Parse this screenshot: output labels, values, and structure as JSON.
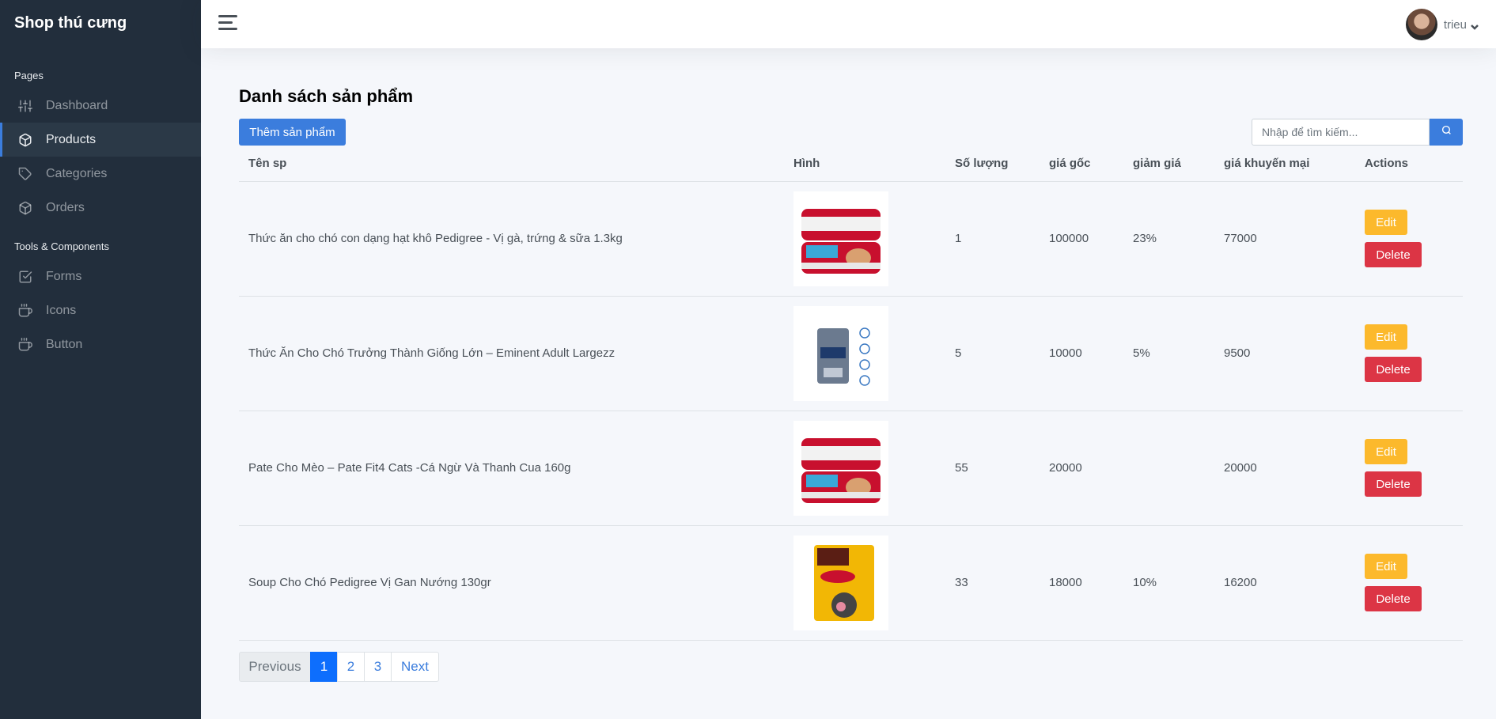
{
  "sidebar": {
    "brand": "Shop thú cưng",
    "section_pages": "Pages",
    "section_tools": "Tools & Components",
    "items": [
      {
        "label": "Dashboard",
        "icon": "sliders-icon"
      },
      {
        "label": "Products",
        "icon": "box-icon",
        "active": true
      },
      {
        "label": "Categories",
        "icon": "tag-icon"
      },
      {
        "label": "Orders",
        "icon": "package-icon"
      },
      {
        "label": "Forms",
        "icon": "check-square-icon"
      },
      {
        "label": "Icons",
        "icon": "coffee-icon"
      },
      {
        "label": "Button",
        "icon": "coffee-icon"
      }
    ]
  },
  "topbar": {
    "username": "trieu"
  },
  "main": {
    "title": "Danh sách sản phẩm",
    "add_button": "Thêm sản phẩm",
    "search_placeholder": "Nhập để tìm kiếm...",
    "columns": [
      "Tên sp",
      "Hình",
      "Số lượng",
      "giá gốc",
      "giảm giá",
      "giá khuyến mại",
      "Actions"
    ],
    "rows": [
      {
        "name": "Thức ăn cho chó con dạng hạt khô Pedigree - Vị gà, trứng & sữa 1.3kg",
        "image": "cat-food-cans",
        "qty": "1",
        "price": "100000",
        "discount": "23%",
        "sale": "77000"
      },
      {
        "name": "Thức Ăn Cho Chó Trưởng Thành Giống Lớn – Eminent Adult Largezz",
        "image": "dog-food-bag",
        "qty": "5",
        "price": "10000",
        "discount": "5%",
        "sale": "9500"
      },
      {
        "name": "Pate Cho Mèo – Pate Fit4 Cats -Cá Ngừ Và Thanh Cua 160g",
        "image": "cat-food-cans",
        "qty": "55",
        "price": "20000",
        "discount": "",
        "sale": "20000"
      },
      {
        "name": "Soup Cho Chó Pedigree Vị Gan Nướng 130gr",
        "image": "pedigree-pouch",
        "qty": "33",
        "price": "18000",
        "discount": "10%",
        "sale": "16200"
      }
    ],
    "edit_label": "Edit",
    "delete_label": "Delete"
  },
  "pagination": {
    "prev": "Previous",
    "pages": [
      "1",
      "2",
      "3"
    ],
    "current": "1",
    "next": "Next"
  },
  "colors": {
    "sidebar_bg": "#222e3c",
    "primary": "#3b7ddd",
    "warning": "#fcb92c",
    "danger": "#dc3545"
  }
}
